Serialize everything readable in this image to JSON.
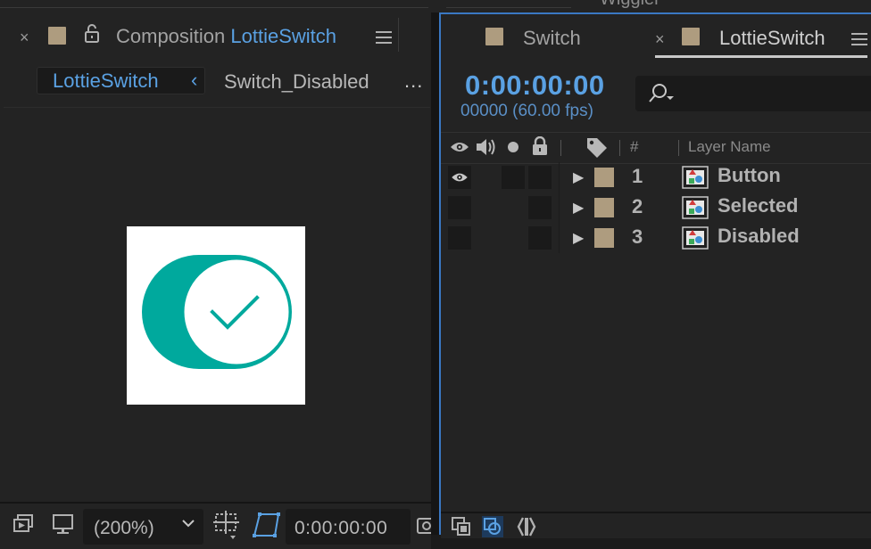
{
  "top": {
    "partial_text": "Wiggler"
  },
  "composition_panel": {
    "tab_prefix": "Composition",
    "tab_comp_name": "LottieSwitch",
    "close_glyph": "×",
    "subtabs": [
      {
        "label": "LottieSwitch",
        "active": true
      },
      {
        "label": "Switch_Disabled",
        "active": false
      }
    ],
    "back_chevron": "‹",
    "overflow": "...",
    "zoom": "(200%)",
    "current_time": "0:00:00:00",
    "switch_colors": {
      "track": "#00a99d",
      "knob": "#ffffff",
      "check": "#00a99d"
    }
  },
  "timeline_panel": {
    "tabs": [
      {
        "label": "Switch",
        "active": false
      },
      {
        "label": "LottieSwitch",
        "active": true
      }
    ],
    "close_glyph": "×",
    "timecode": "0:00:00:00",
    "frame_info": "00000 (60.00 fps)",
    "columns": {
      "number": "#",
      "layer_name": "Layer Name"
    },
    "layers": [
      {
        "number": "1",
        "name": "Button",
        "visible": true
      },
      {
        "number": "2",
        "name": "Selected",
        "visible": false
      },
      {
        "number": "3",
        "name": "Disabled",
        "visible": false
      }
    ],
    "triangle_glyph": "▶"
  },
  "colors": {
    "accent_blue": "#5aa1e3",
    "panel_border_active": "#3a78c3",
    "label_swatch": "#ae9c7f"
  }
}
